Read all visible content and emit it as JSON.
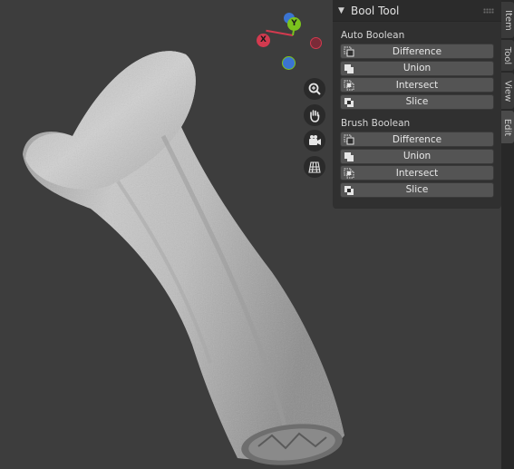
{
  "gizmo": {
    "x_label": "X",
    "y_label": "Y",
    "x_color": "#d33a4f",
    "y_color": "#7bc31e",
    "z_color": "#3b74d2"
  },
  "nav_tools": [
    {
      "name": "zoom-icon"
    },
    {
      "name": "hand-pan-icon"
    },
    {
      "name": "camera-icon"
    },
    {
      "name": "grid-perspective-icon"
    }
  ],
  "panel": {
    "title": "Bool Tool",
    "auto_boolean": {
      "label": "Auto Boolean",
      "buttons": [
        "Difference",
        "Union",
        "Intersect",
        "Slice"
      ]
    },
    "brush_boolean": {
      "label": "Brush Boolean",
      "buttons": [
        "Difference",
        "Union",
        "Intersect",
        "Slice"
      ]
    }
  },
  "tabs": [
    "Item",
    "Tool",
    "View",
    "Edit"
  ]
}
